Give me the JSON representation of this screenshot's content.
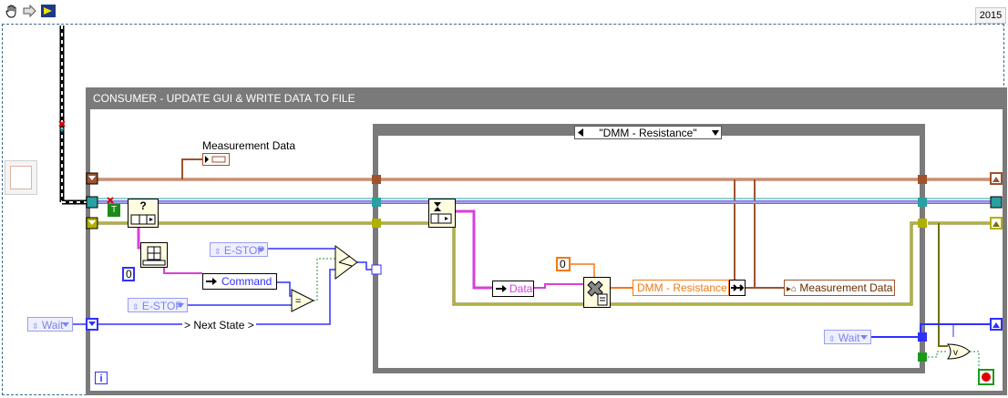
{
  "toolbar": {
    "hand_icon": "hand-icon",
    "arrow_icon": "arrow-icon",
    "play_icon": "play-icon"
  },
  "version_year": "2015",
  "loop": {
    "title": "CONSUMER - UPDATE GUI & WRITE DATA TO FILE",
    "iteration_label": "i"
  },
  "case": {
    "selector_label": "\"DMM - Resistance\""
  },
  "labels": {
    "measurement_data_top": "Measurement Data",
    "measurement_data_bottom": "Measurement Data",
    "command": "Command",
    "data": "Data",
    "dmm_resistance": "DMM - Resistance",
    "next_state": "> Next State >",
    "estop_1": "E-STOP",
    "estop_2": "E-STOP",
    "wait_left": "Wait",
    "wait_right": "Wait",
    "zero_const_1": "0",
    "zero_const_2": "0",
    "question": "?"
  },
  "colors": {
    "string_orange": "#f17a14",
    "brown_wire": "#a0522d",
    "pink_wire": "#d93fd9",
    "blue_wire": "#3030ff",
    "enum_blue": "#7e83e8",
    "frame_gray": "#7a7a7a",
    "cluster_olive": "#b0b000"
  }
}
